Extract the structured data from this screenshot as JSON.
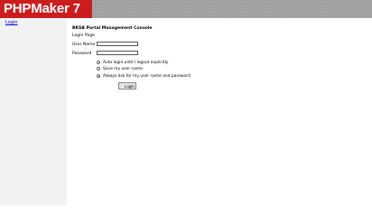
{
  "header": {
    "logo_text": "PHPMaker 7"
  },
  "sidebar": {
    "login_link": "Login"
  },
  "main": {
    "console_title": "BKSB Portal Management Console",
    "page_label": "Login Page",
    "username_label": "User Name",
    "username_value": "",
    "password_label": "Password",
    "password_value": "",
    "remember_options": [
      {
        "label": "Auto login until I logout explicitly",
        "checked": false
      },
      {
        "label": "Save my user name",
        "checked": false
      },
      {
        "label": "Always ask for my user name and password",
        "checked": true
      }
    ],
    "login_button": "Login"
  }
}
